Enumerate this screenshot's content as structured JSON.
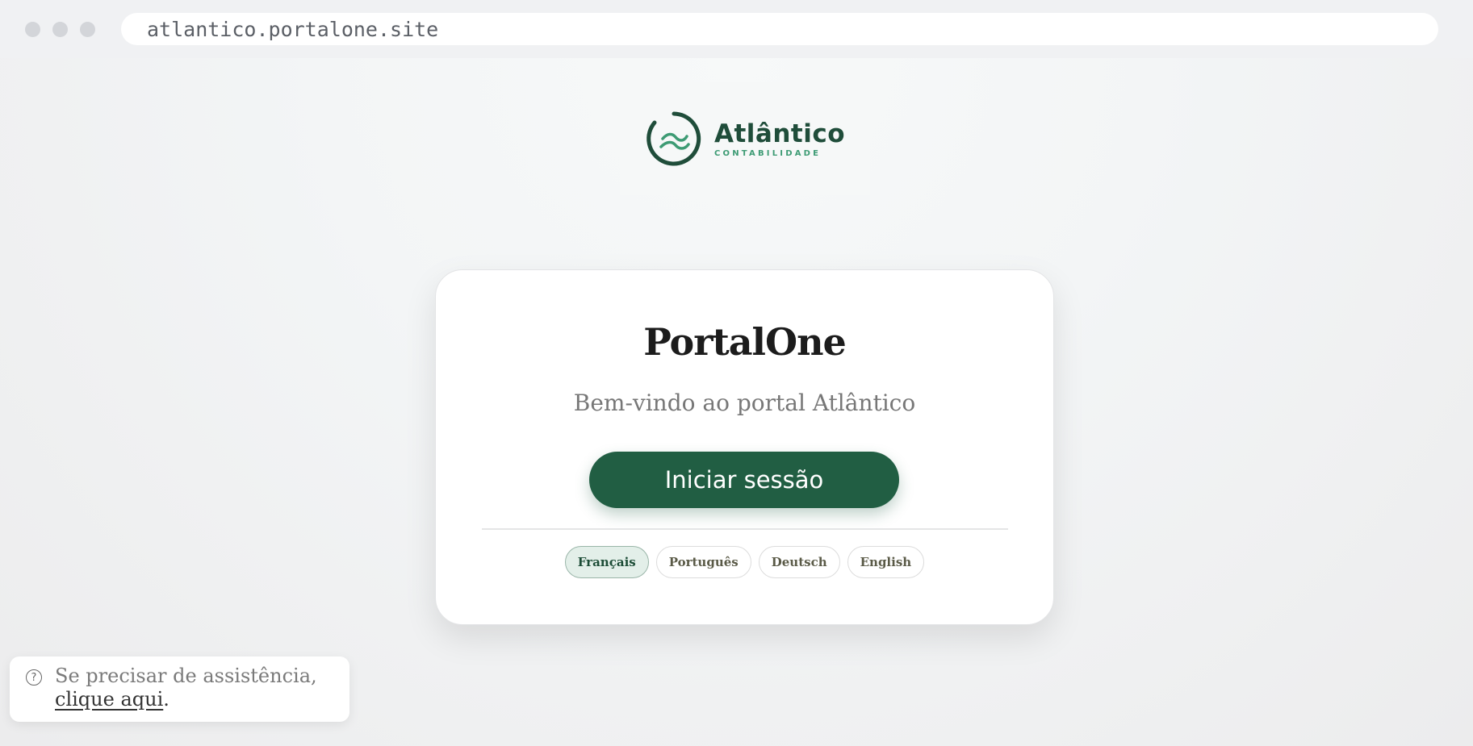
{
  "browser": {
    "url": "atlantico.portalone.site"
  },
  "logo": {
    "name": "Atlântico",
    "subtitle": "CONTABILIDADE",
    "color": "#1f4d3a",
    "accent": "#3d9b74"
  },
  "card": {
    "title": "PortalOne",
    "subtitle": "Bem-vindo ao portal Atlântico",
    "login_button": "Iniciar sessão",
    "languages": [
      {
        "label": "Français",
        "selected": true
      },
      {
        "label": "Português",
        "selected": false
      },
      {
        "label": "Deutsch",
        "selected": false
      },
      {
        "label": "English",
        "selected": false
      }
    ]
  },
  "help": {
    "text": "Se precisar de assistência,",
    "link_text": "clique aqui",
    "suffix": "."
  },
  "colors": {
    "brand_green": "#215e43",
    "selected_lang_bg": "#e3efe9"
  }
}
